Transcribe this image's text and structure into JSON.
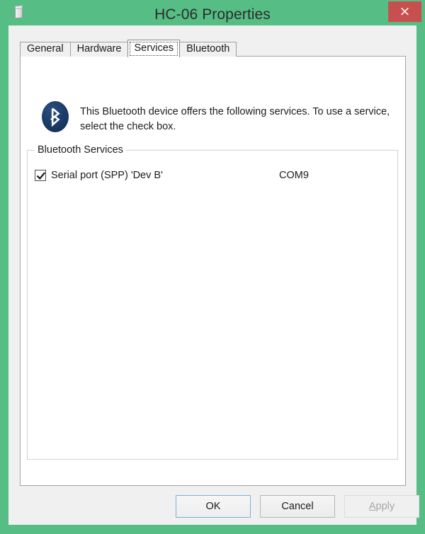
{
  "window": {
    "title": "HC-06 Properties",
    "title_icon": "device-tower-icon",
    "close_label": "×",
    "border_color": "#56bd85",
    "close_button_color": "#c7504f",
    "client_color": "#f0f0f0"
  },
  "tabs": [
    {
      "label": "General",
      "selected": false
    },
    {
      "label": "Hardware",
      "selected": false
    },
    {
      "label": "Services",
      "selected": true
    },
    {
      "label": "Bluetooth",
      "selected": false
    }
  ],
  "page": {
    "icon": "bluetooth-icon",
    "icon_color": "#1b3a65",
    "description": "This Bluetooth device offers the following services. To use a service, select the check box."
  },
  "group": {
    "label": "Bluetooth Services",
    "services": [
      {
        "name": "Serial port (SPP) 'Dev B'",
        "port": "COM9",
        "checked": true
      }
    ]
  },
  "buttons": {
    "ok": {
      "label": "OK",
      "state": "default"
    },
    "cancel": {
      "label": "Cancel",
      "state": "normal"
    },
    "apply": {
      "accel": "A",
      "rest": "pply",
      "state": "disabled"
    }
  }
}
